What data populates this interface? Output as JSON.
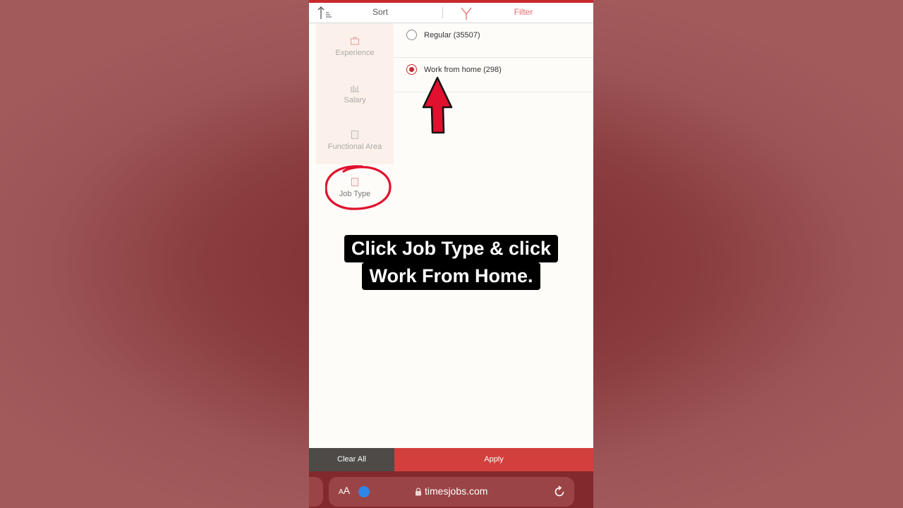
{
  "topbar": {
    "sort_label": "Sort",
    "filter_label": "Filter",
    "sort_icon": "sort-icon",
    "filter_icon": "filter-icon"
  },
  "categories": [
    {
      "label": "Experience",
      "icon": "briefcase-icon"
    },
    {
      "label": "Salary",
      "icon": "money-icon"
    },
    {
      "label": "Functional Area",
      "icon": "building-icon"
    },
    {
      "label": "Job Type",
      "icon": "building-icon",
      "active": true
    }
  ],
  "options": [
    {
      "label": "Regular (35507)",
      "checked": false
    },
    {
      "label": "Work from home (298)",
      "checked": true
    }
  ],
  "caption": {
    "line1": "Click Job Type & click",
    "line2": "Work From Home."
  },
  "buttons": {
    "clear_all": "Clear All",
    "apply": "Apply"
  },
  "browser": {
    "text_size_label_small": "A",
    "text_size_label_large": "A",
    "url": "timesjobs.com"
  },
  "colors": {
    "accent": "#c7292e",
    "apply_bg": "#d23f3c",
    "clear_bg": "#4d4a47",
    "browser_bg": "#82292d",
    "annotation_red": "#e0102e"
  }
}
